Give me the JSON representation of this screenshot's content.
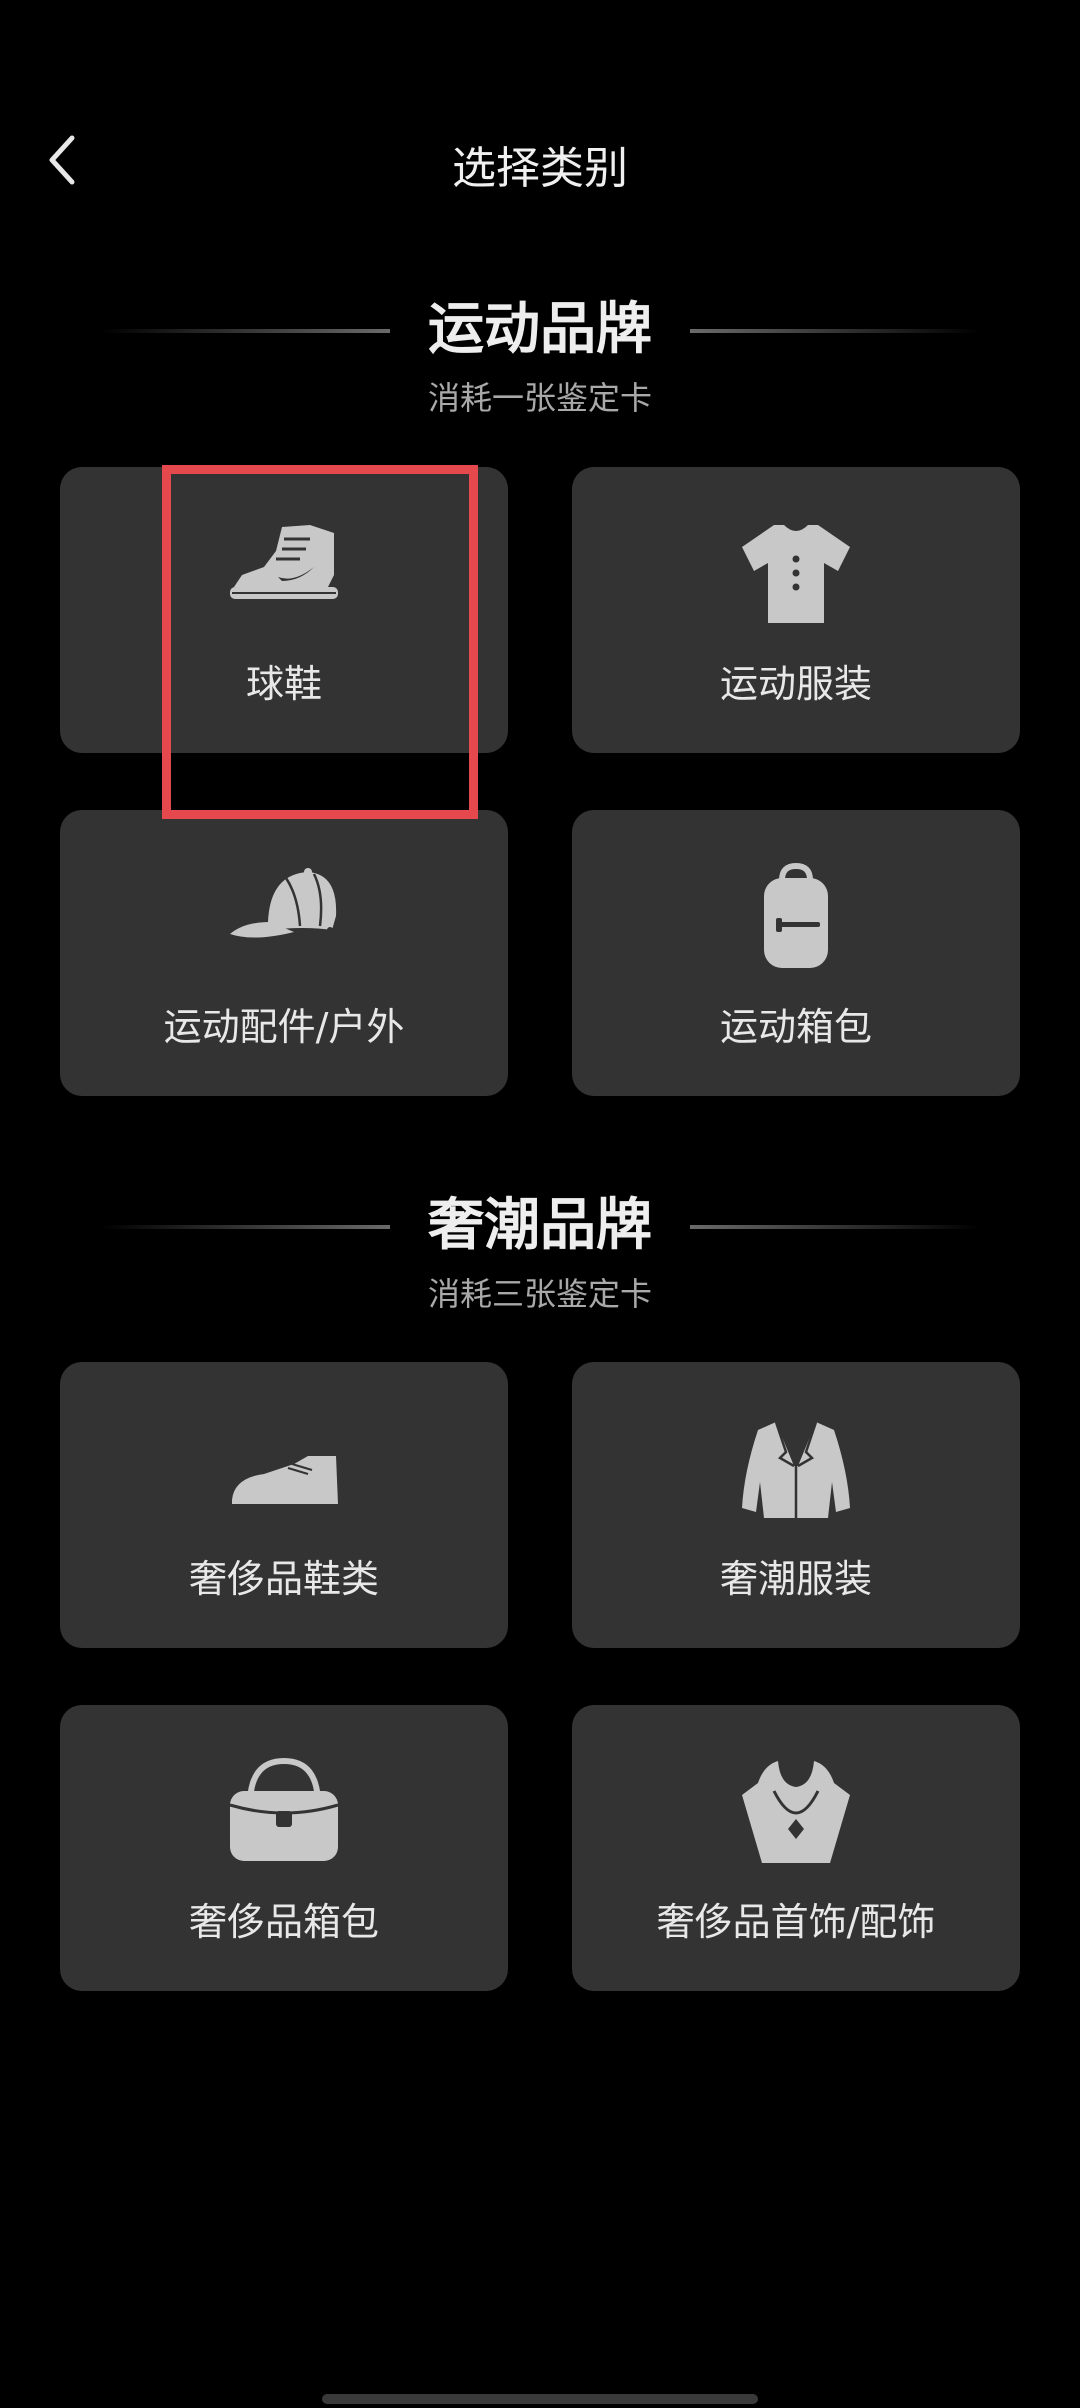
{
  "header": {
    "title": "选择类别"
  },
  "sections": [
    {
      "title": "运动品牌",
      "subtitle": "消耗一张鉴定卡",
      "items": [
        {
          "label": "球鞋",
          "icon": "sneaker-icon"
        },
        {
          "label": "运动服装",
          "icon": "tshirt-icon"
        },
        {
          "label": "运动配件/户外",
          "icon": "cap-icon"
        },
        {
          "label": "运动箱包",
          "icon": "backpack-icon"
        }
      ]
    },
    {
      "title": "奢潮品牌",
      "subtitle": "消耗三张鉴定卡",
      "items": [
        {
          "label": "奢侈品鞋类",
          "icon": "dress-shoe-icon"
        },
        {
          "label": "奢潮服装",
          "icon": "suit-jacket-icon"
        },
        {
          "label": "奢侈品箱包",
          "icon": "handbag-icon"
        },
        {
          "label": "奢侈品首饰/配饰",
          "icon": "necklace-icon"
        }
      ]
    }
  ],
  "colors": {
    "background": "#000000",
    "card": "#333333",
    "icon": "#c8c8c8",
    "highlight": "#e5484d"
  }
}
